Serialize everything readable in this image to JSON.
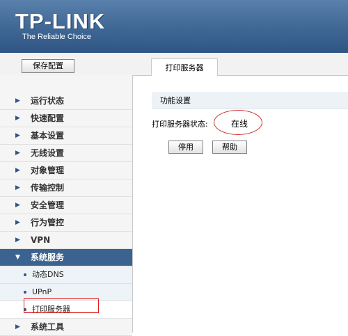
{
  "brand": {
    "logo": "TP-LINK",
    "tagline": "The Reliable Choice"
  },
  "toolbar": {
    "save_label": "保存配置",
    "active_tab": "打印服务器"
  },
  "sidebar": {
    "items": [
      {
        "label": "运行状态"
      },
      {
        "label": "快速配置"
      },
      {
        "label": "基本设置"
      },
      {
        "label": "无线设置"
      },
      {
        "label": "对象管理"
      },
      {
        "label": "传输控制"
      },
      {
        "label": "安全管理"
      },
      {
        "label": "行为管控"
      },
      {
        "label": "VPN"
      },
      {
        "label": "系统服务"
      }
    ],
    "sub_items": [
      {
        "label": "动态DNS"
      },
      {
        "label": "UPnP"
      },
      {
        "label": "打印服务器"
      }
    ],
    "last_item": {
      "label": "系统工具"
    }
  },
  "main": {
    "section_title": "功能设置",
    "status_label": "打印服务器状态:",
    "status_value": "在线",
    "disable_label": "停用",
    "help_label": "帮助"
  },
  "colors": {
    "header": "#3f6794",
    "active_menu": "#3c6390",
    "annotation": "#e02020"
  }
}
